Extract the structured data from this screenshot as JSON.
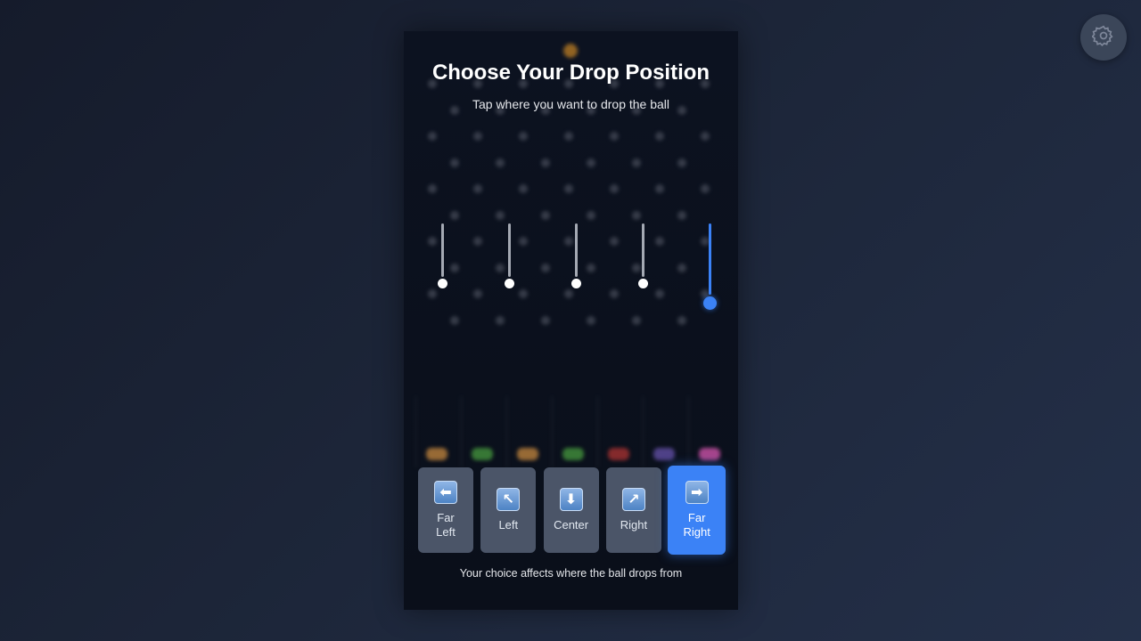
{
  "title": "Choose Your Drop Position",
  "subtitle": "Tap where you want to drop the ball",
  "footer_note": "Your choice affects where the ball drops from",
  "settings": {
    "icon": "gear-icon"
  },
  "options": [
    {
      "label": "Far\nLeft",
      "icon": "arrow-left-icon",
      "glyph": "⬅",
      "selected": false
    },
    {
      "label": "Left",
      "icon": "arrow-up-left-icon",
      "glyph": "↖",
      "selected": false
    },
    {
      "label": "Center",
      "icon": "arrow-down-icon",
      "glyph": "⬇",
      "selected": false
    },
    {
      "label": "Right",
      "icon": "arrow-up-right-icon",
      "glyph": "↗",
      "selected": false
    },
    {
      "label": "Far\nRight",
      "icon": "arrow-right-icon",
      "glyph": "➡",
      "selected": true
    }
  ],
  "colors": {
    "accent": "#3b82f6",
    "button": "#4b5568",
    "panel": "#0a0f1a"
  }
}
